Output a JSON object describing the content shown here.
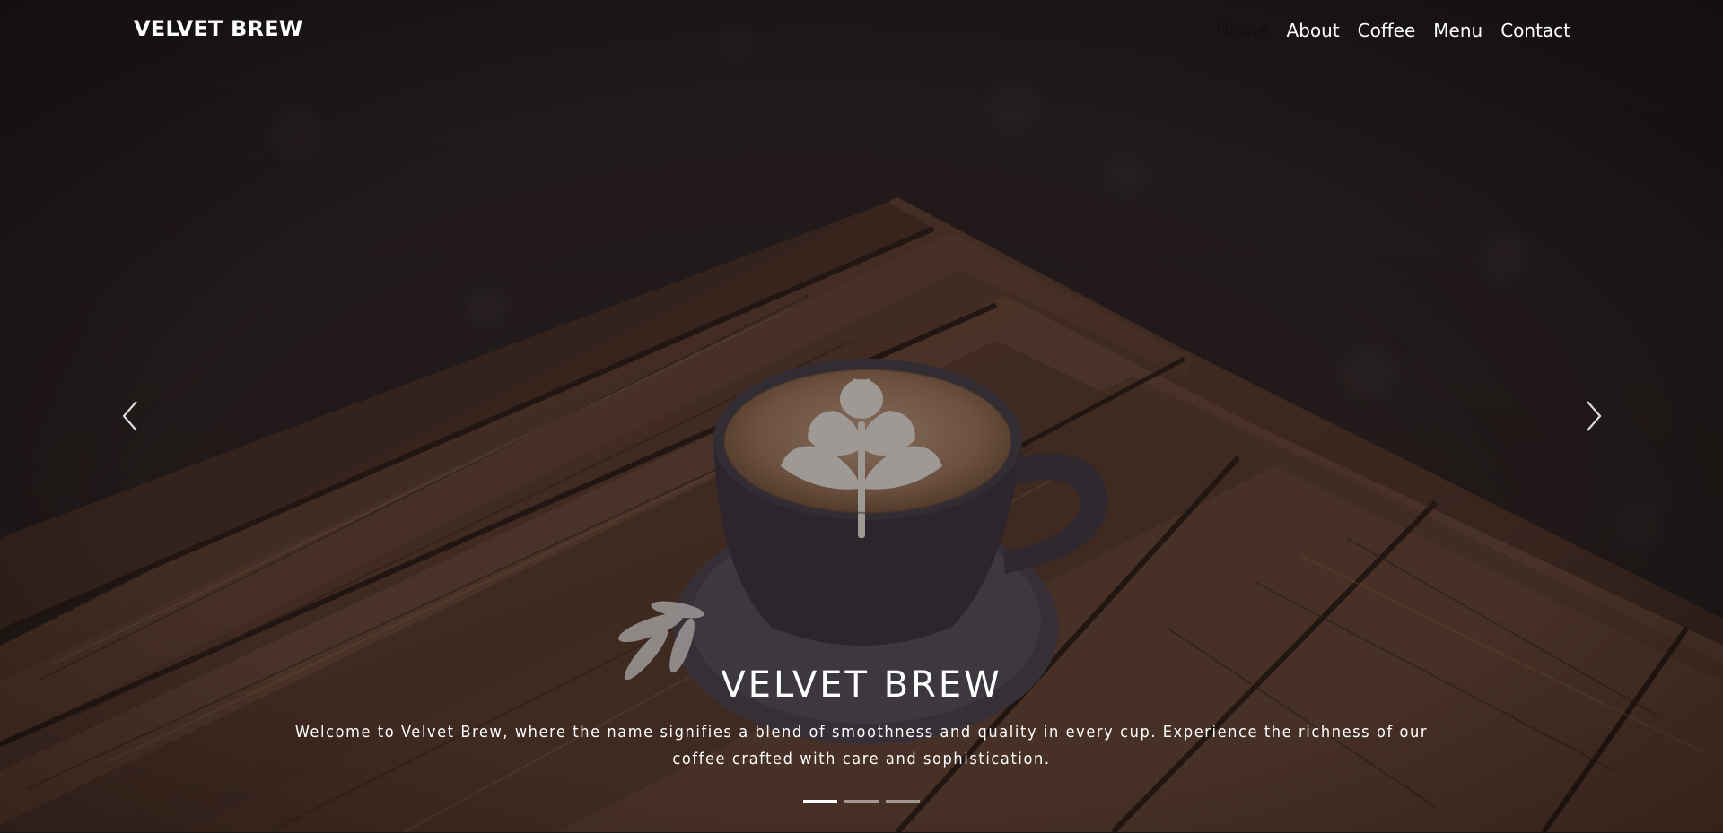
{
  "brand": "VELVET BREW",
  "nav": {
    "items": [
      "Home",
      "About",
      "Coffee",
      "Menu",
      "Contact"
    ],
    "active": "Home"
  },
  "hero": {
    "title": "VELVET BREW",
    "text": "Welcome to Velvet Brew, where the name signifies a blend of smoothness and quality in every cup. Experience the richness of our coffee crafted with care and sophistication.",
    "slides": 3,
    "active_slide": 1,
    "prev_icon": "chevron-left-icon",
    "next_icon": "chevron-right-icon"
  },
  "colors": {
    "background": "#2c2424",
    "text": "#ffffff",
    "active_nav": "#141010"
  }
}
